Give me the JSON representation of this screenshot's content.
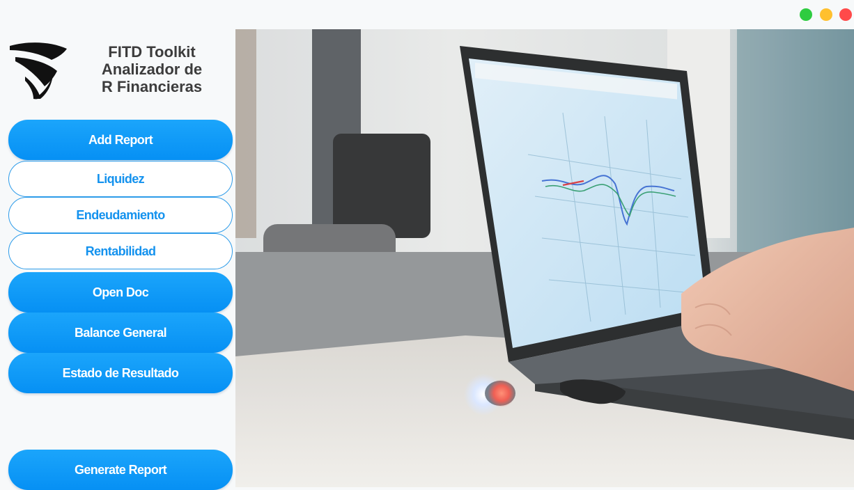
{
  "app": {
    "title_lines": [
      "FITD Toolkit",
      "Analizador de",
      "R Financieras"
    ]
  },
  "window_controls": [
    "maximize",
    "minimize",
    "close"
  ],
  "sidebar": {
    "add_report": "Add Report",
    "liquidez": "Liquidez",
    "endeudamiento": "Endeudamiento",
    "rentabilidad": "Rentabilidad",
    "open_doc": "Open Doc",
    "balance_general": "Balance General",
    "estado_resultado": "Estado de Resultado",
    "generate_report": "Generate Report"
  },
  "colors": {
    "accent": "#0a96f5",
    "outline": "#2c9be9",
    "title_text": "#3c3c3c",
    "dot_green": "#2ecc40",
    "dot_yellow": "#ffc02e",
    "dot_red": "#ff4a4a"
  },
  "icons": [
    "shield-logo-icon"
  ]
}
